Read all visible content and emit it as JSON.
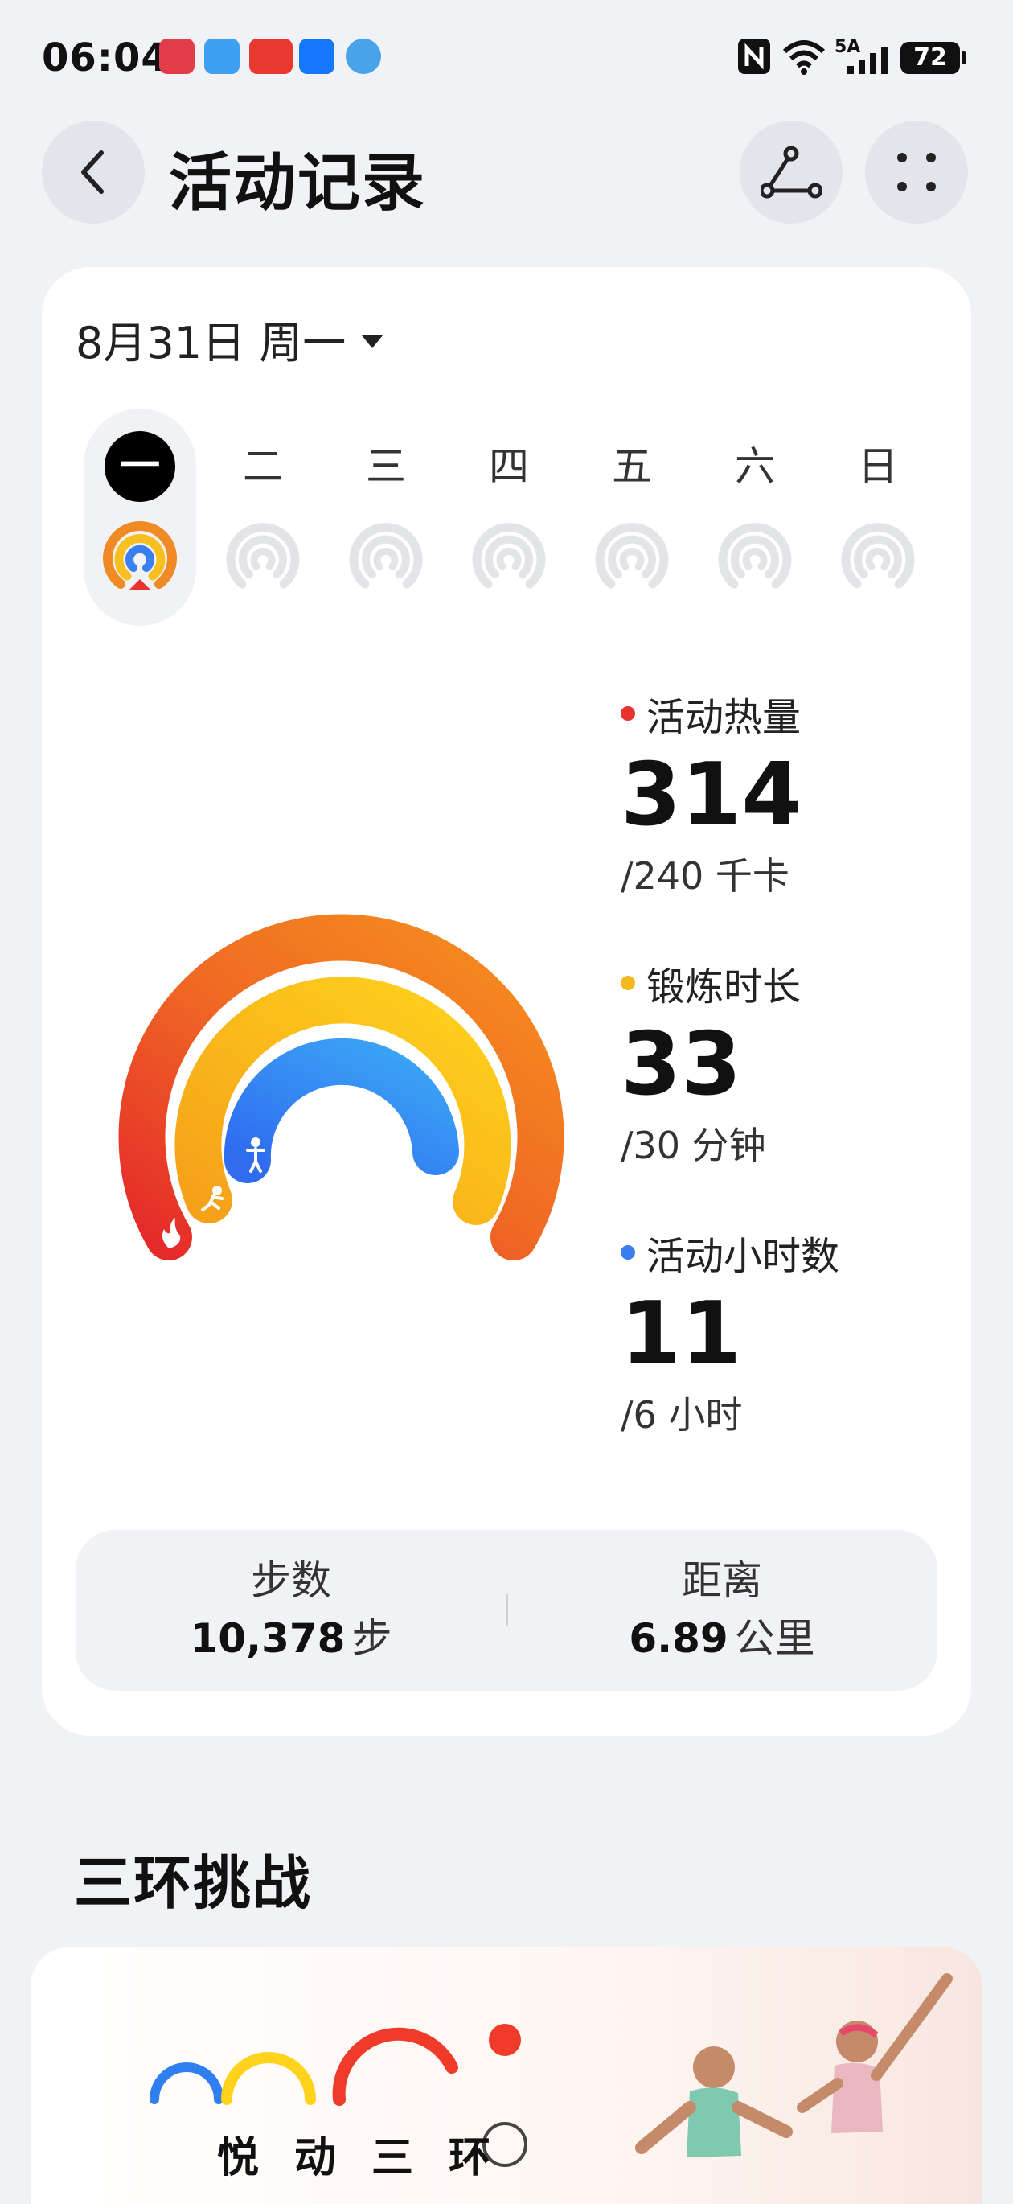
{
  "status_bar": {
    "time": "06:04",
    "app_icons": [
      "reader-icon",
      "weather-icon",
      "toutiao-icon",
      "alipay-icon",
      "browser-icon"
    ],
    "network": "5A",
    "battery": "72"
  },
  "header": {
    "title": "活动记录"
  },
  "date": {
    "label": "8月31日 周一"
  },
  "week": {
    "days": [
      {
        "label": "一",
        "selected": true
      },
      {
        "label": "二",
        "selected": false
      },
      {
        "label": "三",
        "selected": false
      },
      {
        "label": "四",
        "selected": false
      },
      {
        "label": "五",
        "selected": false
      },
      {
        "label": "六",
        "selected": false
      },
      {
        "label": "日",
        "selected": false
      }
    ]
  },
  "stats": {
    "calories": {
      "label": "活动热量",
      "value": "314",
      "goal": "/240 千卡",
      "color": "#e8332e"
    },
    "exercise": {
      "label": "锻炼时长",
      "value": "33",
      "goal": "/30 分钟",
      "color": "#f5b81e"
    },
    "stand": {
      "label": "活动小时数",
      "value": "11",
      "goal": "/6 小时",
      "color": "#3a7ff0"
    }
  },
  "summary": {
    "steps": {
      "label": "步数",
      "value": "10,378",
      "unit": "步"
    },
    "distance": {
      "label": "距离",
      "value": "6.89",
      "unit": "公里"
    }
  },
  "challenge": {
    "title": "三环挑战",
    "banner_text": "悦动三环"
  }
}
